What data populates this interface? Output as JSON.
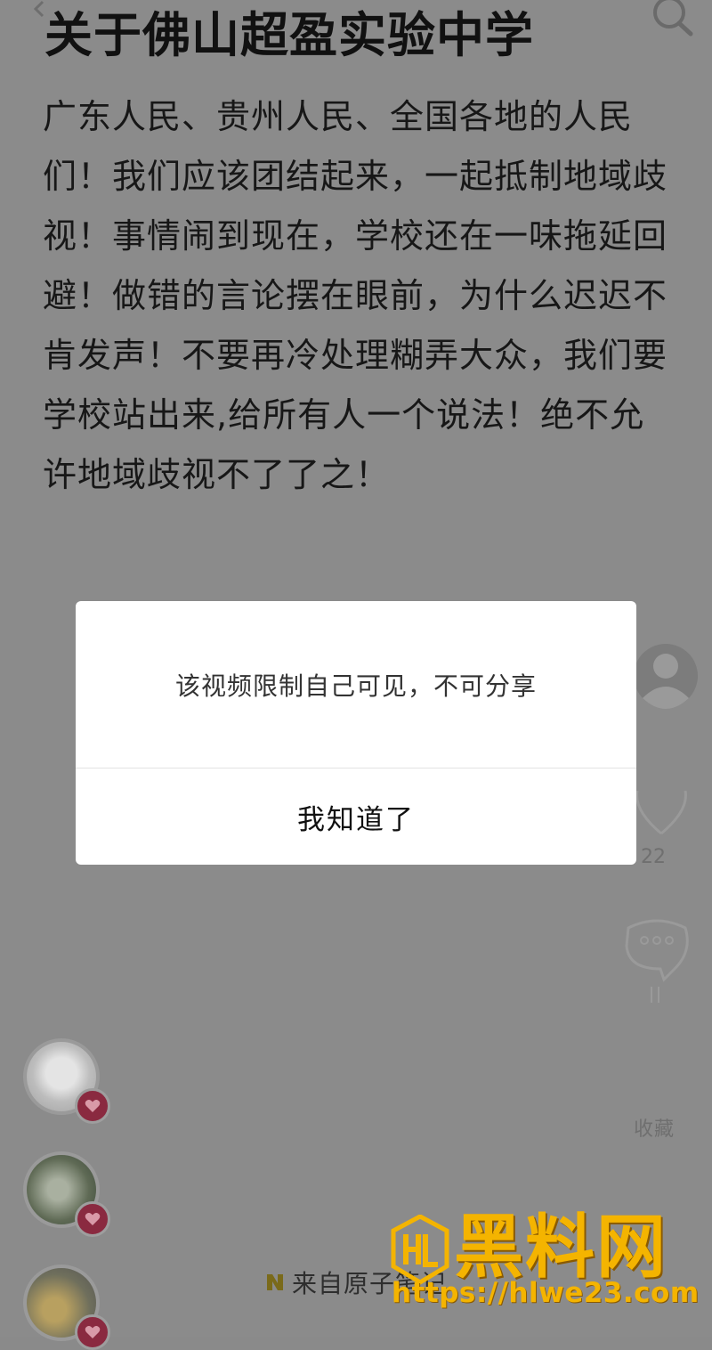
{
  "post": {
    "title": "关于佛山超盈实验中学",
    "body": "广东人民、贵州人民、全国各地的人民们！我们应该团结起来，一起抵制地域歧视！事情闹到现在，学校还在一味拖延回避！做错的言论摆在眼前，为什么迟迟不肯发声！不要再冷处理糊弄大众，我们要学校站出来,给所有人一个说法！绝不允许地域歧视不了了之！"
  },
  "top_bar": {
    "back_icon": "chevron-left-icon",
    "search_icon": "search-icon"
  },
  "right_rail": {
    "avatar_icon": "user-avatar-icon",
    "like_icon": "heart-icon",
    "like_count": "22",
    "comment_icon": "comment-bubble-icon",
    "collect_label": "收藏"
  },
  "avatars": [
    {
      "icon": "avatar",
      "badge_icon": "heart-icon"
    },
    {
      "icon": "avatar",
      "badge_icon": "heart-icon"
    },
    {
      "icon": "avatar",
      "badge_icon": "heart-icon"
    }
  ],
  "source": {
    "icon": "app-logo-icon",
    "label": "来自原子笔记"
  },
  "watermark": {
    "name": "黑料网",
    "url": "https://hlwe23.com"
  },
  "dialog": {
    "message": "该视频限制自己可见，不可分享",
    "confirm_label": "我知道了"
  },
  "colors": {
    "overlay": "#8b8b8b",
    "dialog_bg": "#ffffff",
    "watermark": "#f4b400",
    "badge": "#8a2a40"
  }
}
